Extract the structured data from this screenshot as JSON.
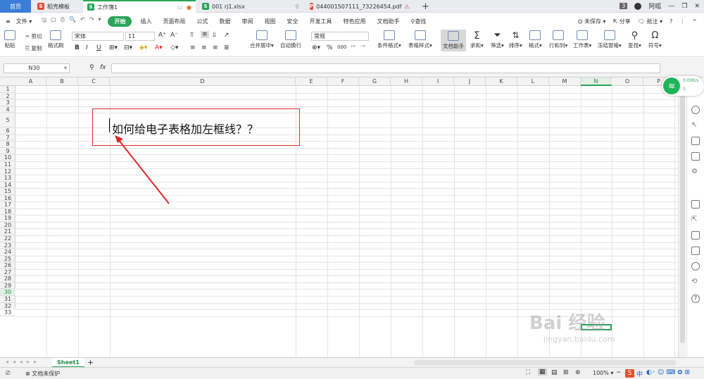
{
  "tabs": {
    "home": "首页",
    "items": [
      {
        "label": "稻壳模板",
        "icon": "wps-docer-icon"
      },
      {
        "label": "工作簿1",
        "icon": "spreadsheet-icon"
      },
      {
        "label": "001 rj1.xlsx",
        "icon": "spreadsheet-icon"
      },
      {
        "label": "044001507111_73226454.pdf",
        "icon": "pdf-icon"
      }
    ],
    "add": "+",
    "page_count": "3",
    "user": "阿呱"
  },
  "menu": {
    "file": "文件",
    "items": [
      "开始",
      "插入",
      "页面布局",
      "公式",
      "数据",
      "审阅",
      "视图",
      "安全",
      "开发工具",
      "特色应用",
      "文档助手"
    ],
    "search": "查找",
    "unsaved": "未保存",
    "share": "分享",
    "annotate": "批注"
  },
  "ribbon": {
    "paste": "粘贴",
    "cut": "剪切",
    "copy": "复制",
    "format_painter": "格式刷",
    "font_name": "宋体",
    "font_size": "11",
    "merge_center": "合并居中",
    "wrap_text": "自动换行",
    "number_format": "常规",
    "conditional_format": "条件格式",
    "table_style": "表格样式",
    "doc_helper": "文档助手",
    "sum": "求和",
    "filter": "筛选",
    "sort": "排序",
    "format": "格式",
    "rows_cols": "行和列",
    "worksheet": "工作表",
    "freeze": "冻结窗格",
    "find": "查找",
    "symbol": "符号",
    "bold": "B",
    "italic": "I",
    "underline": "U",
    "percent": "%",
    "thousands": "000"
  },
  "formula_bar": {
    "cell_ref": "N30",
    "fx": "fx",
    "value": ""
  },
  "grid": {
    "columns": [
      "A",
      "B",
      "C",
      "D",
      "E",
      "F",
      "G",
      "H",
      "I",
      "J",
      "K",
      "L",
      "M",
      "N",
      "O",
      "P"
    ],
    "selected_column": "N",
    "rows": [
      "1",
      "2",
      "3",
      "4",
      "5",
      "6",
      "7",
      "8",
      "9",
      "10",
      "11",
      "12",
      "13",
      "14",
      "15",
      "16",
      "17",
      "18",
      "19",
      "20",
      "21",
      "22",
      "23",
      "24",
      "25",
      "26",
      "27",
      "28",
      "29",
      "30",
      "31",
      "32",
      "33"
    ],
    "selected_row": "30",
    "cell_d5": "如何给电子表格加左框线？？"
  },
  "network_widget": {
    "speed": "0.00K/s",
    "count": "1"
  },
  "sheets": {
    "active": "Sheet1",
    "add": "+"
  },
  "status": {
    "protect": "文档未保护",
    "zoom": "100%",
    "ime": "中"
  },
  "watermark": {
    "brand": "Bai 经验",
    "url": "jingyan.baidu.com"
  }
}
